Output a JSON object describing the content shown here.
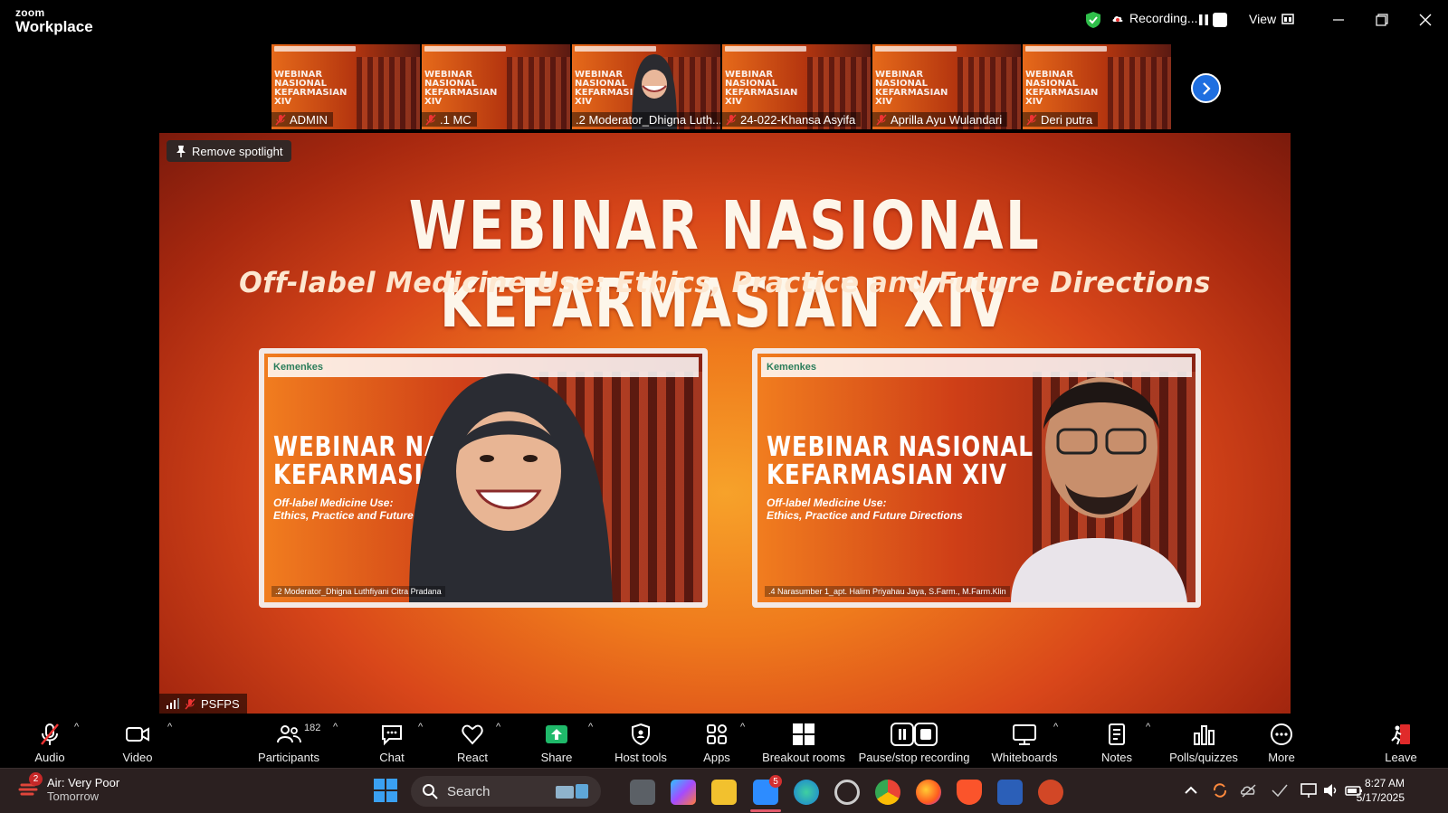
{
  "app": {
    "brand_small": "zoom",
    "brand_large": "Workplace"
  },
  "titlebar": {
    "recording_label": "Recording...",
    "view_label": "View"
  },
  "thumbnails": [
    {
      "name": "ADMIN",
      "title": "WEBINAR NASIONAL KEFARMASIAN XIV"
    },
    {
      "name": ".1 MC",
      "title": "WEBINAR NASIONAL KEFARMASIAN XIV"
    },
    {
      "name": ".2 Moderator_Dhigna Luth...",
      "title": "WEBINAR NASIONAL KEFARMASIAN XIV"
    },
    {
      "name": "24-022-Khansa Asyifa",
      "title": "WEBINAR NASIONAL KEFARMASIAN XIV"
    },
    {
      "name": "Aprilla Ayu Wulandari",
      "title": "WEBINAR NASIONAL KEFARMASIAN XIV"
    },
    {
      "name": "Deri putra",
      "title": "WEBINAR NASIONAL KEFARMASIAN XIV"
    }
  ],
  "main": {
    "spotlight_label": "Remove spotlight",
    "slide_title": "WEBINAR NASIONAL KEFARMASIAN XIV",
    "slide_subtitle": "Off-label Medicine Use: Ethics, Practice and Future Directions",
    "panel_left": {
      "logo_text": "Kemenkes",
      "title_line1": "WEBINAR NASIO",
      "title_line2": "KEFARMASIAN",
      "sub_line1": "Off-label Medicine Use:",
      "sub_line2": "Ethics, Practice and Future",
      "name": ".2 Moderator_Dhigna Luthfiyani Citra Pradana"
    },
    "panel_right": {
      "logo_text": "Kemenkes",
      "title_line1": "WEBINAR NASIONAL",
      "title_line2": "KEFARMASIAN XIV",
      "sub_line1": "Off-label Medicine Use:",
      "sub_line2": "Ethics, Practice and Future Directions",
      "name": ".4 Narasumber 1_apt. Halim Priyahau Jaya, S.Farm., M.Farm.Klin"
    },
    "bottom_name": "PSFPS"
  },
  "toolbar": {
    "audio": "Audio",
    "video": "Video",
    "participants": "Participants",
    "participants_count": "182",
    "chat": "Chat",
    "react": "React",
    "share": "Share",
    "host_tools": "Host tools",
    "apps": "Apps",
    "breakout": "Breakout rooms",
    "pause_stop": "Pause/stop recording",
    "whiteboards": "Whiteboards",
    "notes": "Notes",
    "polls": "Polls/quizzes",
    "more": "More",
    "leave": "Leave"
  },
  "taskbar": {
    "weather_badge": "2",
    "weather_line1": "Air: Very Poor",
    "weather_line2": "Tomorrow",
    "search_label": "Search",
    "zoom_badge": "5",
    "time": "8:27 AM",
    "date": "5/17/2025"
  },
  "colors": {
    "accent_blue": "#1f6fe0",
    "share_green": "#1fb96a",
    "leave_red": "#e02a2a",
    "secure_green": "#2fbe4a"
  }
}
